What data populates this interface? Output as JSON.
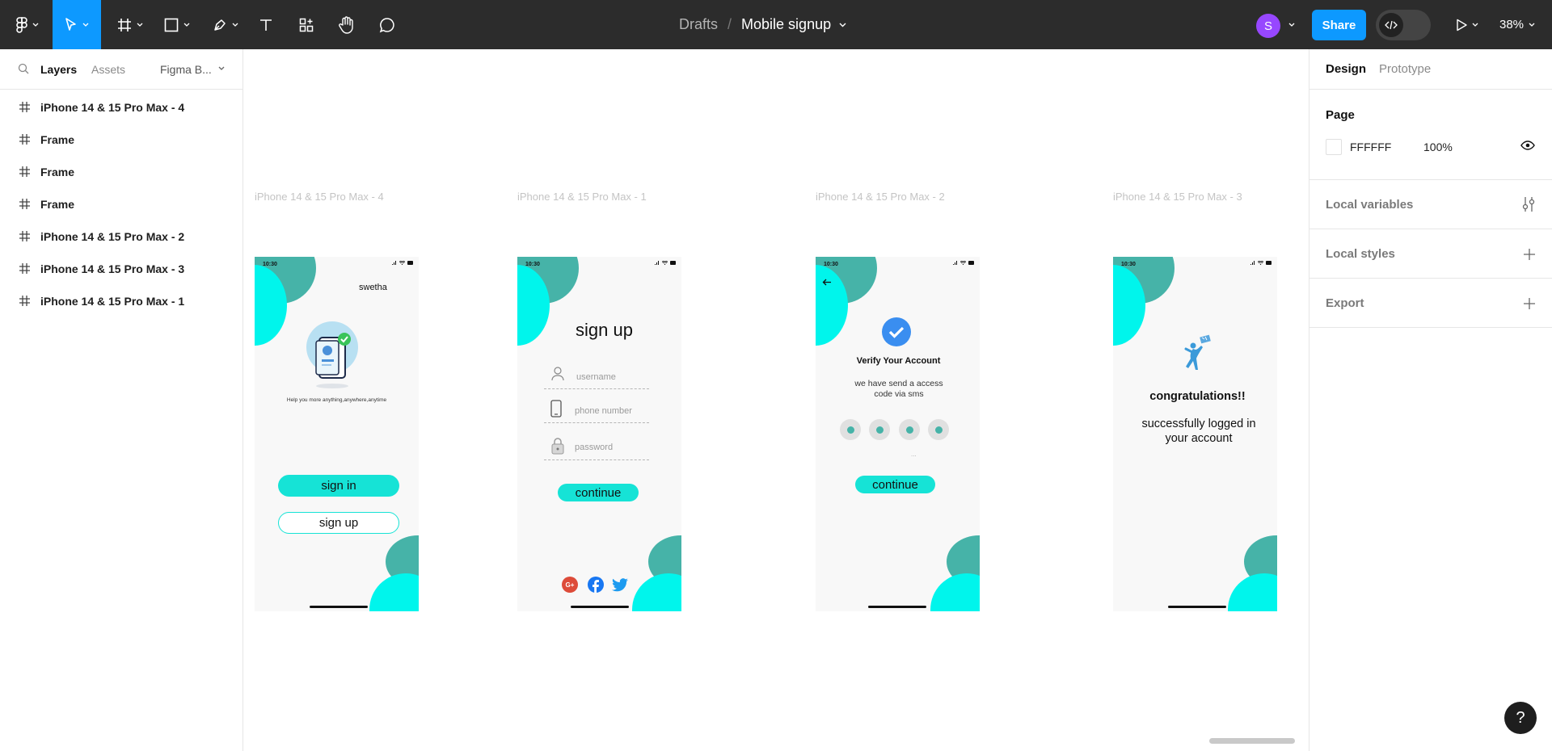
{
  "toolbar": {
    "breadcrumb_root": "Drafts",
    "breadcrumb_sep": "/",
    "file_name": "Mobile signup",
    "avatar_initial": "S",
    "share_label": "Share",
    "zoom": "38%"
  },
  "left_panel": {
    "tab_layers": "Layers",
    "tab_assets": "Assets",
    "library": "Figma B...",
    "layers": [
      "iPhone 14 & 15 Pro Max - 4",
      "Frame",
      "Frame",
      "Frame",
      "iPhone 14 & 15 Pro Max - 2",
      "iPhone 14 & 15 Pro Max - 3",
      "iPhone 14 & 15 Pro Max - 1"
    ]
  },
  "right_panel": {
    "tab_design": "Design",
    "tab_prototype": "Prototype",
    "page_heading": "Page",
    "page_color": "FFFFFF",
    "page_opacity": "100%",
    "local_variables": "Local variables",
    "local_styles": "Local styles",
    "export": "Export"
  },
  "canvas": {
    "frames": [
      {
        "label": "iPhone 14 & 15 Pro Max - 4",
        "time": "10:30",
        "username": "swetha",
        "tagline": "Help you more anything,anywhere,anytime",
        "sign_in": "sign in",
        "sign_up": "sign up"
      },
      {
        "label": "iPhone 14 & 15 Pro Max - 1",
        "time": "10:30",
        "title": "sign up",
        "username_ph": "username",
        "phone_ph": "phone number",
        "password_ph": "password",
        "continue": "continue"
      },
      {
        "label": "iPhone 14 & 15 Pro Max - 2",
        "time": "10:30",
        "heading": "Verify Your Account",
        "subtext": "we have send a access code via sms",
        "dots": "...",
        "continue": "continue"
      },
      {
        "label": "iPhone 14 & 15 Pro Max - 3",
        "time": "10:30",
        "heading": "congratulations!!",
        "subtext": "successfully logged in your account"
      }
    ]
  },
  "colors": {
    "accent": "#0d99ff",
    "teal_dark": "#46b3a8",
    "cyan": "#00f5ec",
    "button": "#16e3d6"
  },
  "help_label": "?"
}
